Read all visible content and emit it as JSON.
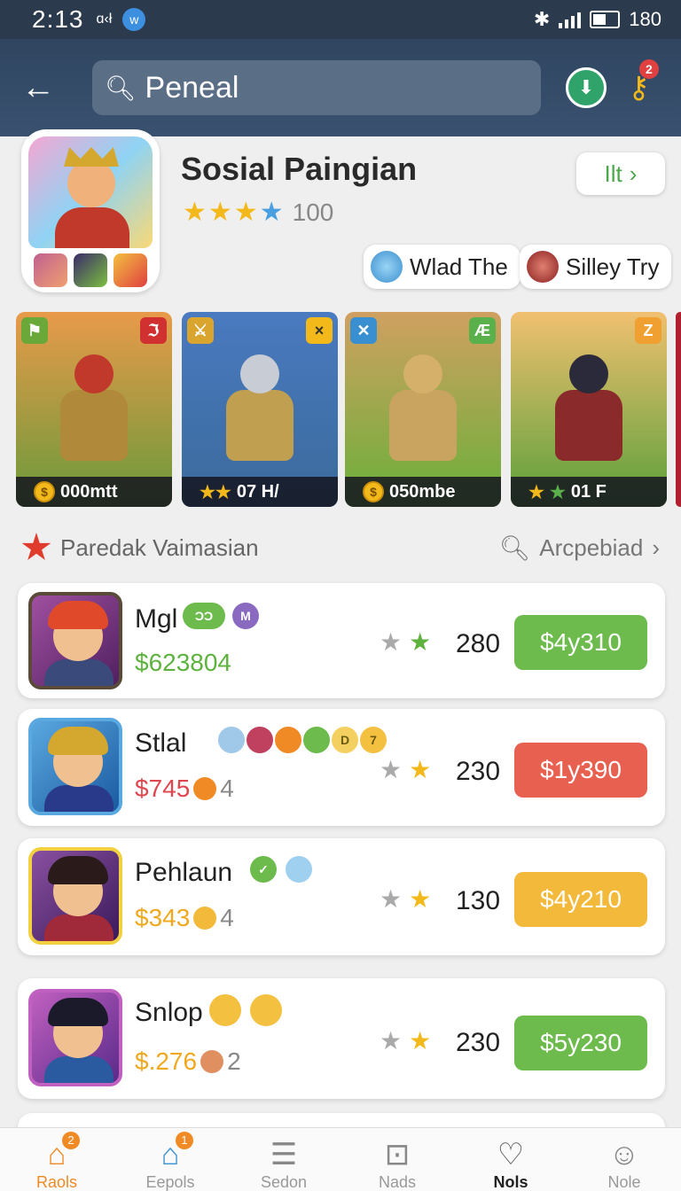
{
  "status_bar": {
    "time": "2:13",
    "misc": "ɑ‹ł",
    "battery": "180"
  },
  "header": {
    "search_value": "Peneal",
    "key_badge": "2"
  },
  "profile": {
    "title": "Sosial Paingian",
    "rating_text": "100",
    "follow_label": "Ilt",
    "chips": [
      {
        "label": "Wlad The"
      },
      {
        "label": "Silley Try"
      }
    ]
  },
  "hero_cards": [
    {
      "label": "000mtt",
      "tag": "ℑ"
    },
    {
      "label": "07 H/",
      "tag": "×"
    },
    {
      "label": "050mbe",
      "tag": "Æ"
    },
    {
      "label": "01 F",
      "tag": "Z"
    }
  ],
  "section": {
    "title": "Paredak Vaimasian",
    "right_label": "Arcpebiad"
  },
  "rows": [
    {
      "name": "Mgl",
      "price": "$623804",
      "price_extra": "",
      "count": "280",
      "button": "$4y310",
      "badges": [
        "ƆƆ",
        "M"
      ]
    },
    {
      "name": "Stlal",
      "price": "$745",
      "price_extra": "4",
      "count": "230",
      "button": "$1y390",
      "badges": [
        "",
        "",
        "",
        "",
        "D",
        "7"
      ]
    },
    {
      "name": "Pehlaun",
      "price": "$343",
      "price_extra": "4",
      "count": "130",
      "button": "$4y210",
      "badges": [
        "✓",
        ""
      ]
    },
    {
      "name": "Snlop",
      "price": "$.276",
      "price_extra": "2",
      "count": "230",
      "button": "$5y230",
      "badges": [
        "",
        ""
      ]
    }
  ],
  "nav": [
    {
      "label": "Raols",
      "icon": "home-icon",
      "badge": "2"
    },
    {
      "label": "Eepols",
      "icon": "house-icon",
      "badge": "1"
    },
    {
      "label": "Sedon",
      "icon": "list-icon",
      "badge": ""
    },
    {
      "label": "Nads",
      "icon": "camera-icon",
      "badge": ""
    },
    {
      "label": "Nols",
      "icon": "heart-icon",
      "badge": ""
    },
    {
      "label": "Nole",
      "icon": "person-icon",
      "badge": ""
    }
  ],
  "colors": {
    "header": "#2f4560",
    "green": "#6cbb4c",
    "red": "#e8604f",
    "orange": "#f3b93a",
    "price_green": "#5db33e",
    "price_red": "#e0464f",
    "price_orange": "#f0a81c"
  }
}
